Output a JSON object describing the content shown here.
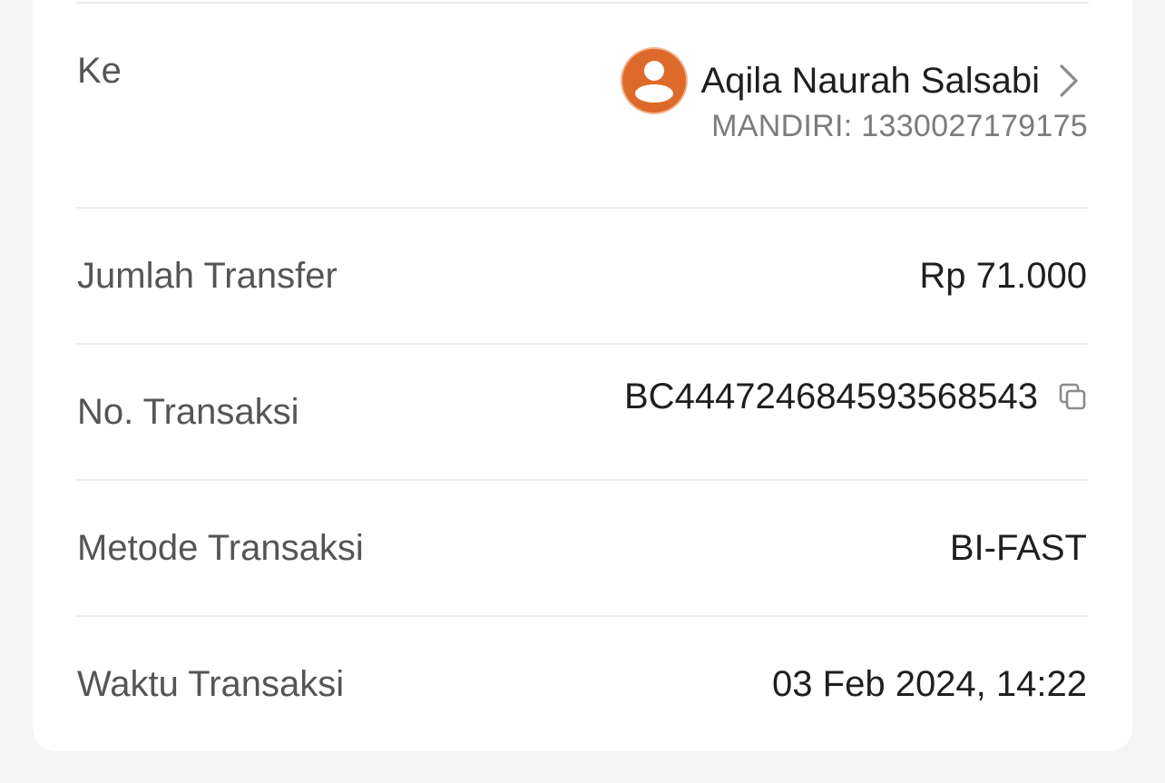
{
  "details": {
    "to": {
      "label": "Ke",
      "name": "Aqila Naurah Salsabi",
      "bank_account": "MANDIRI: 1330027179175",
      "avatar_color": "#dd6a2a"
    },
    "amount": {
      "label": "Jumlah Transfer",
      "value": "Rp 71.000"
    },
    "transaction_no": {
      "label": "No. Transaksi",
      "value": "BC444724684593568543"
    },
    "method": {
      "label": "Metode Transaksi",
      "value": "BI-FAST"
    },
    "time": {
      "label": "Waktu Transaksi",
      "value": "03 Feb 2024, 14:22"
    }
  },
  "icons": {
    "avatar": "person-icon",
    "chevron": "chevron-right-icon",
    "copy": "copy-icon"
  }
}
